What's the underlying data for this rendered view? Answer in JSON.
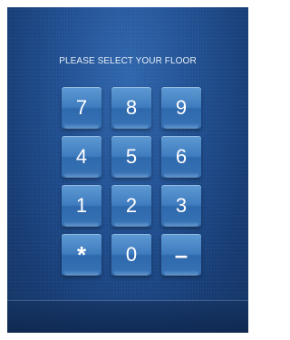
{
  "prompt": {
    "text": "PLEASE SELECT YOUR FLOOR"
  },
  "keypad": {
    "keys": [
      {
        "label": "7"
      },
      {
        "label": "8"
      },
      {
        "label": "9"
      },
      {
        "label": "4"
      },
      {
        "label": "5"
      },
      {
        "label": "6"
      },
      {
        "label": "1"
      },
      {
        "label": "2"
      },
      {
        "label": "3"
      },
      {
        "label": "*"
      },
      {
        "label": "0"
      },
      {
        "label": "–"
      }
    ]
  },
  "colors": {
    "background": "#1f4d8e",
    "key_face": "#3f7cbf",
    "text": "#ffffff"
  }
}
